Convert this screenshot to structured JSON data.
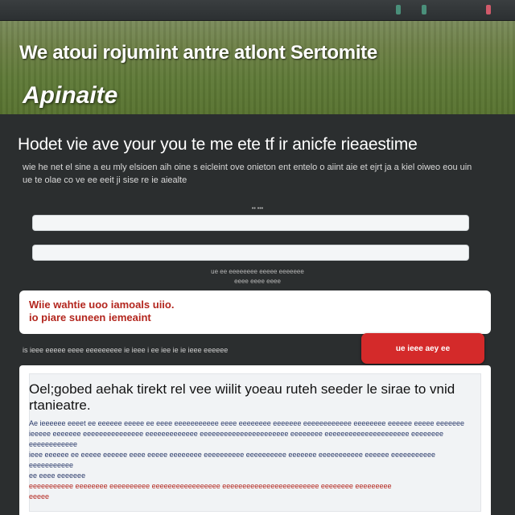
{
  "topbar": {
    "icons": [
      "status-icon-1",
      "status-icon-2",
      "status-icon-3"
    ],
    "icon_colors": [
      "#4a8f7a",
      "#4a8f7a",
      "#d05a6a"
    ]
  },
  "hero": {
    "headline": "We atoui rojumint antre atlont Sertomite",
    "brand": "Apinaite"
  },
  "main": {
    "heading": "Hodet vie ave your you te me ete tf ir anicfe rieaestime",
    "intro": "wie he net el sine a eu mly elsioen aih oine s eicleint ove onieton ent entelo o aiint aie et ejrt ja a kiel oiweo eou uin ue te olae co ve ee eeit ji sise re ie aiealte",
    "field1_hint": "•• •••",
    "field1_placeholder": "",
    "field2_placeholder": "",
    "note_line1": "ue ee eeeeeeee eeeee eeeeeee",
    "note_line2": "eeee eeee eeee"
  },
  "alert": {
    "line1": "Wiie wahtie uoo iamoals uiio.",
    "line2": "io piare suneen iemeaint"
  },
  "action": {
    "text": "is ieee eeeee eeee eeeeeeeee ie ieee i ee iee ie ie ieee eeeeee",
    "button_label": "ue ieee aey ee"
  },
  "card": {
    "title": "Oel;gobed aehak tirekt rel vee wiilit yoeau ruteh seeder le sirae to vnid rtanieatre.",
    "body_line1": "Ae ieeeeee eeeet ee eeeeee eeeee ee eeee eeeeeeeeeee eeee eeeeeeee eeeeeee eeeeeeeeeeee eeeeeeee eeeeee eeeee eeeeeee",
    "body_line2": "ieeeee eeeeeee eeeeeeeeeeeeeee eeeeeeeeeeeee eeeeeeeeeeeeeeeeeeeeee eeeeeeee eeeeeeeeeeeeeeeeeeeee eeeeeeee eeeeeeeeeeee",
    "body_line3": "ieee eeeeee ee eeeee eeeeee eeee eeeee eeeeeeee eeeeeeeeee eeeeeeeeee eeeeeee eeeeeeeeeee eeeeee eeeeeeeeeee eeeeeeeeeee",
    "body_line4": "ee eeee eeeeeee",
    "body_red": "eeeeeeeeeee eeeeeeee eeeeeeeeee eeeeeeeeeeeeeeeee eeeeeeeeeeeeeeeeeeeeeeee eeeeeeee eeeeeeeee",
    "body_red2": "eeeee"
  }
}
